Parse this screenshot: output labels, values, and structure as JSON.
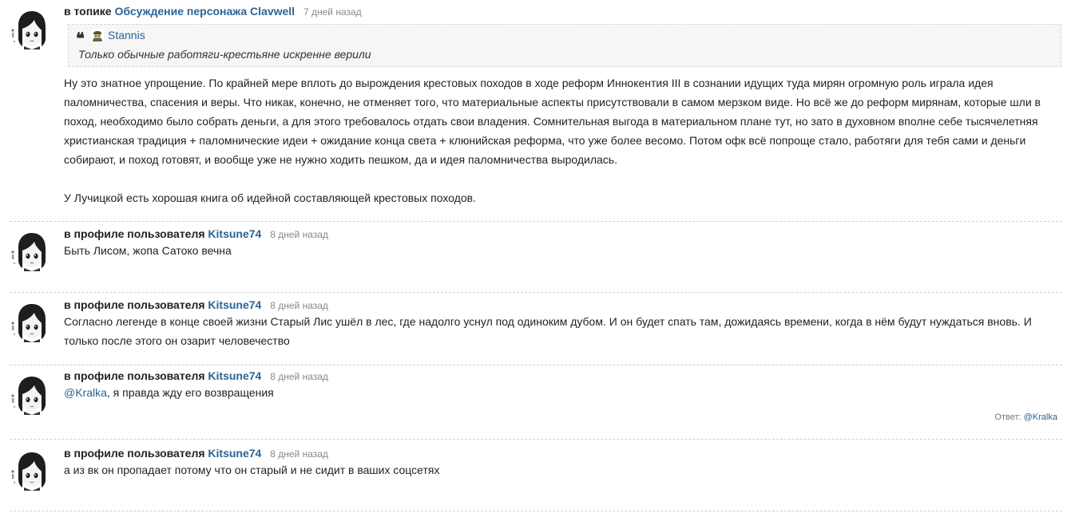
{
  "comments": [
    {
      "prefix": "в топике",
      "target": "Обсуждение персонажа Clavwell",
      "time": "7 дней назад",
      "quote": {
        "author": "Stannis",
        "text": "Только обычные работяги-крестьяне искренне верили"
      },
      "paragraphs": [
        "Ну это знатное упрощение. По крайней мере вплоть до вырождения крестовых походов в ходе реформ Иннокентия III в сознании идущих туда мирян огромную роль играла идея паломничества, спасения и веры. Что никак, конечно, не отменяет того, что материальные аспекты присутствовали в самом мерзком виде. Но всё же до реформ мирянам, которые шли в поход, необходимо было собрать деньги, а для этого требовалось отдать свои владения. Сомнительная выгода в материальном плане тут, но зато в духовном вполне себе тысячелетняя христианская традиция + паломнические идеи + ожидание конца света + клюнийская реформа, что уже более весомо. Потом офк всё попроще стало, работяги для тебя сами и деньги собирают, и поход готовят, и вообще уже не нужно ходить пешком, да и идея паломничества выродилась.",
        "У Лучицкой есть хорошая книга об идейной составляющей крестовых походов."
      ]
    },
    {
      "prefix": "в профиле пользователя",
      "target": "Kitsune74",
      "time": "8 дней назад",
      "text": "Быть Лисом, жопа Сатоко вечна"
    },
    {
      "prefix": "в профиле пользователя",
      "target": "Kitsune74",
      "time": "8 дней назад",
      "text": "Согласно легенде в конце своей жизни Старый Лис ушёл в лес, где надолго уснул под одиноким дубом. И он будет спать там, дожидаясь времени, когда в нём будут нуждаться вновь. И только после этого он озарит человечество"
    },
    {
      "prefix": "в профиле пользователя",
      "target": "Kitsune74",
      "time": "8 дней назад",
      "mention": "@Kralka",
      "text": ", я правда жду его возвращения",
      "reply_label": "Ответ:",
      "reply_to": "@Kralka"
    },
    {
      "prefix": "в профиле пользователя",
      "target": "Kitsune74",
      "time": "8 дней назад",
      "text": "а из вк он пропадает потому что он старый и не сидит в ваших соцсетях"
    }
  ],
  "colors": {
    "link": "#2a6496",
    "text": "#222222",
    "muted": "#888888",
    "divider": "#d2d2d2",
    "quote_bg": "#f6f6f6"
  },
  "icons": {
    "avatar": "avatar-icon",
    "quote_mark": "quote-mark-icon",
    "quote_avatar": "soldier-avatar-icon"
  }
}
